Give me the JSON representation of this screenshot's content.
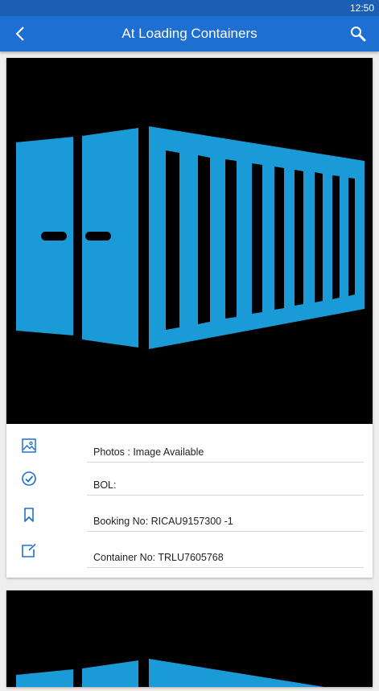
{
  "status_bar": {
    "time": "12:50"
  },
  "app_bar": {
    "title": "At Loading Containers",
    "back_icon": "chevron-left-icon",
    "search_icon": "search-icon"
  },
  "colors": {
    "app_bar": "#1e6fd2",
    "status_bar": "#1a5fb4",
    "container": "#1a9ad6",
    "icon": "#1e6fd2"
  },
  "cards": [
    {
      "image": "container-illustration",
      "fields": [
        {
          "icon": "image-icon",
          "text": "Photos : Image Available"
        },
        {
          "icon": "check-circle-icon",
          "text": "BOL:"
        },
        {
          "icon": "bookmark-icon",
          "text": "Booking No: RICAU9157300 -1"
        },
        {
          "icon": "edit-box-icon",
          "text": "Container No: TRLU7605768"
        }
      ]
    },
    {
      "image": "container-illustration"
    }
  ]
}
